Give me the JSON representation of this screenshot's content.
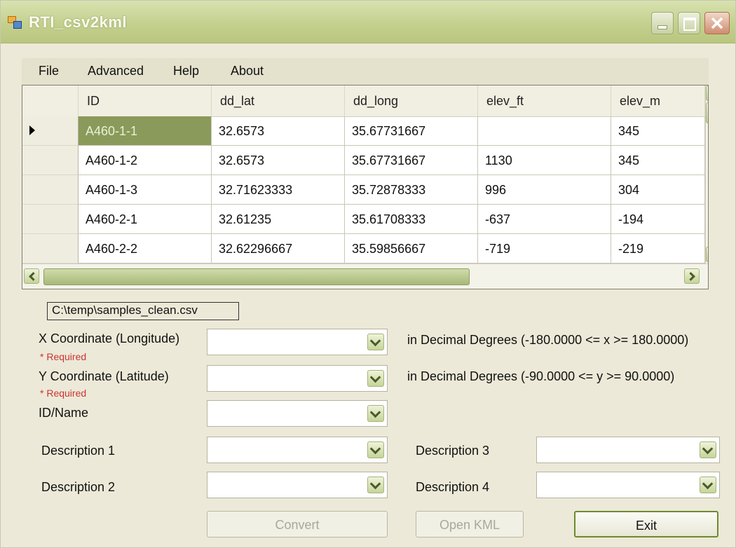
{
  "window": {
    "title": "RTI_csv2kml"
  },
  "menu": [
    "File",
    "Advanced",
    "Help",
    "About"
  ],
  "grid": {
    "columns": [
      "ID",
      "dd_lat",
      "dd_long",
      "elev_ft",
      "elev_m"
    ],
    "rows": [
      [
        "A460-1-1",
        "32.6573",
        "35.67731667",
        "",
        "345"
      ],
      [
        "A460-1-2",
        "32.6573",
        "35.67731667",
        "1130",
        "345"
      ],
      [
        "A460-1-3",
        "32.71623333",
        "35.72878333",
        "996",
        "304"
      ],
      [
        "A460-2-1",
        "32.61235",
        "35.61708333",
        "-637",
        "-194"
      ],
      [
        "A460-2-2",
        "32.62296667",
        "35.59856667",
        "-719",
        "-219"
      ]
    ],
    "current_row": 0
  },
  "file_path": "C:\\temp\\samples_clean.csv",
  "form": {
    "x_label": "X Coordinate (Longitude)",
    "x_required": "* Required",
    "x_hint": "in Decimal Degrees (-180.0000 <= x >= 180.0000)",
    "y_label": "Y Coordinate (Latitude)",
    "y_required": "* Required",
    "y_hint": "in Decimal Degrees (-90.0000 <= y >= 90.0000)",
    "id_label": "ID/Name",
    "desc1_label": "Description 1",
    "desc2_label": "Description 2",
    "desc3_label": "Description 3",
    "desc4_label": "Description 4"
  },
  "buttons": {
    "convert": "Convert",
    "open_kml": "Open KML",
    "exit": "Exit"
  }
}
